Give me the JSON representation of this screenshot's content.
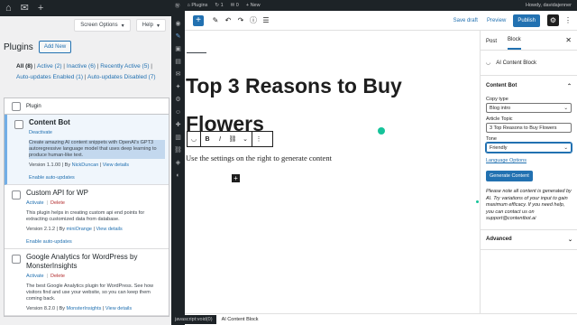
{
  "left_window": {
    "topbar_icons": [
      "home-icon",
      "comment-icon",
      "plus-icon"
    ],
    "screen_options_label": "Screen Options",
    "help_label": "Help",
    "title": "Plugins",
    "add_new_label": "Add New",
    "filters": {
      "all": "All",
      "all_count": "(8)",
      "active": "Active",
      "active_count": "(2)",
      "inactive": "Inactive",
      "inactive_count": "(6)",
      "recently_active": "Recently Active",
      "recently_active_count": "(5)",
      "auto_enabled": "Auto-updates Enabled",
      "auto_enabled_count": "(1)",
      "auto_disabled": "Auto-updates Disabled",
      "auto_disabled_count": "(7)"
    },
    "column_header": "Plugin",
    "plugins": [
      {
        "name": "Content Bot",
        "action1": "Deactivate",
        "action2": "",
        "description": "Create amazing AI content snippets with OpenAI's GPT3 autoregressive language model that uses deep learning to produce human-like text.",
        "version": "Version 1.1.00 | By",
        "author": "NickDuncan",
        "details": "View details",
        "auto_updates": "Enable auto-updates"
      },
      {
        "name": "Custom API for WP",
        "action1": "Activate",
        "action2": "Delete",
        "description": "This plugin helps in creating custom api end points for extracting customized data from database.",
        "version": "Version 2.1.2 | By",
        "author": "miniOrange",
        "details": "View details",
        "auto_updates": "Enable auto-updates"
      },
      {
        "name": "Google Analytics for WordPress by MonsterInsights",
        "action1": "Activate",
        "action2": "Delete",
        "description": "The best Google Analytics plugin for WordPress. See how visitors find and use your website, so you can keep them coming back.",
        "version": "Version 8.2.0 | By",
        "author": "MonsterInsights",
        "details": "View details"
      }
    ]
  },
  "editor": {
    "admin_bar": {
      "site": "Plugins",
      "updates": "1",
      "comments": "0",
      "new": "+ New",
      "howdy": "Howdy, davidajenner"
    },
    "toolbar": {
      "save_draft": "Save draft",
      "preview": "Preview",
      "publish": "Publish"
    },
    "post_title": "Top 3 Reasons to Buy Flowers",
    "block_toolbar": {
      "bold": "B",
      "italic": "I",
      "link": "⛓",
      "more": "⌄",
      "options": "⋮"
    },
    "paragraph": "Use the settings on the right to generate content",
    "sidebar": {
      "tab_post": "Post",
      "tab_block": "Block",
      "block_name": "AI Content Block",
      "panel_title": "Content Bot",
      "copy_type_label": "Copy type",
      "copy_type_value": "Blog intro",
      "topic_label": "Article Topic",
      "topic_value": "3 Top Reasons to Buy Flowers",
      "tone_label": "Tone",
      "tone_value": "Friendly",
      "language_options": "Language Options",
      "generate_label": "Generate Content",
      "note": "Please note all content is generated by AI. Try variations of your input to gain maximum efficacy. If you need help, you can contact us on support@contentbot.ai",
      "advanced_label": "Advanced"
    },
    "footer": {
      "status_url": "javascript:void(0)",
      "breadcrumb": "AI Content Block"
    }
  }
}
